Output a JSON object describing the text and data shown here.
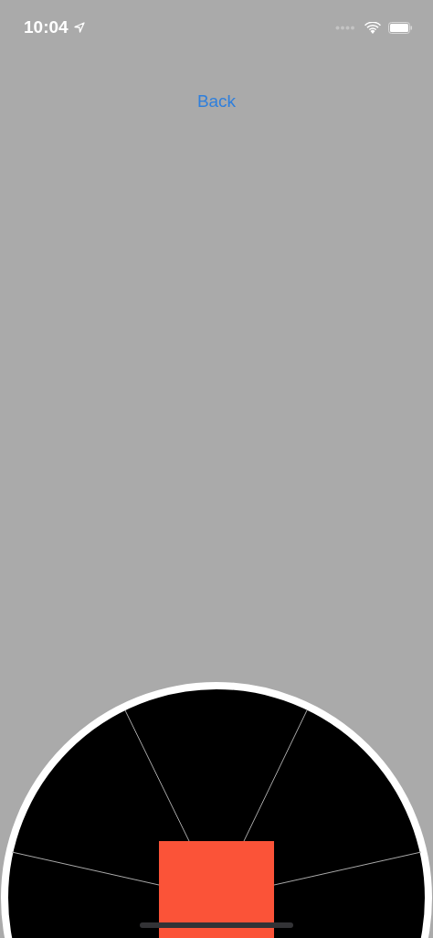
{
  "status_bar": {
    "time": "10:04"
  },
  "back_button": {
    "label": "Back"
  }
}
